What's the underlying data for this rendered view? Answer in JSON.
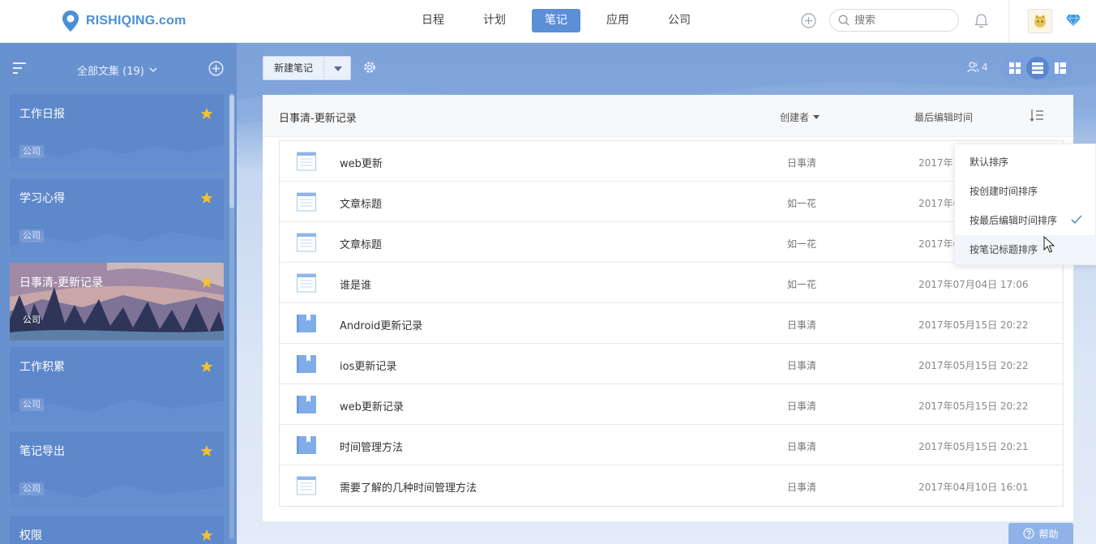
{
  "brand": {
    "name": "RISHIQING.com",
    "color": "#4a8fd8"
  },
  "nav": {
    "items": [
      {
        "label": "日程"
      },
      {
        "label": "计划"
      },
      {
        "label": "笔记",
        "active": true
      },
      {
        "label": "应用"
      },
      {
        "label": "公司"
      }
    ]
  },
  "search": {
    "placeholder": "搜索"
  },
  "sidebar": {
    "collection_label": "全部文集 (19)",
    "cards": [
      {
        "title": "工作日报",
        "tag": "公司",
        "starred": true
      },
      {
        "title": "学习心得",
        "tag": "公司",
        "starred": true
      },
      {
        "title": "日事清-更新记录",
        "tag": "公司",
        "starred": true,
        "selected": true
      },
      {
        "title": "工作积累",
        "tag": "公司",
        "starred": true
      },
      {
        "title": "笔记导出",
        "tag": "公司",
        "starred": true
      },
      {
        "title": "权限",
        "tag": "",
        "starred": true
      }
    ]
  },
  "toolbar": {
    "new_note_label": "新建笔记",
    "member_count": "4"
  },
  "panel": {
    "title": "日事清-更新记录",
    "col_creator": "创建者",
    "col_edited": "最后编辑时间"
  },
  "notes": [
    {
      "title": "web更新",
      "creator": "日事清",
      "time": "2017年1",
      "type": "doc"
    },
    {
      "title": "文章标题",
      "creator": "如一花",
      "time": "2017年0",
      "type": "doc"
    },
    {
      "title": "文章标题",
      "creator": "如一花",
      "time": "2017年0",
      "type": "doc"
    },
    {
      "title": "谁是谁",
      "creator": "如一花",
      "time": "2017年07月04日 17:06",
      "type": "doc"
    },
    {
      "title": "Android更新记录",
      "creator": "日事清",
      "time": "2017年05月15日 20:22",
      "type": "book"
    },
    {
      "title": "ios更新记录",
      "creator": "日事清",
      "time": "2017年05月15日 20:22",
      "type": "book"
    },
    {
      "title": "web更新记录",
      "creator": "日事清",
      "time": "2017年05月15日 20:22",
      "type": "book"
    },
    {
      "title": "时间管理方法",
      "creator": "日事清",
      "time": "2017年05月15日 20:21",
      "type": "book"
    },
    {
      "title": "需要了解的几种时间管理方法",
      "creator": "日事清",
      "time": "2017年04月10日 16:01",
      "type": "doc"
    }
  ],
  "sort_menu": {
    "items": [
      {
        "label": "默认排序"
      },
      {
        "label": "按创建时间排序"
      },
      {
        "label": "按最后编辑时间排序",
        "checked": true
      },
      {
        "label": "按笔记标题排序",
        "hovered": true
      }
    ]
  },
  "help": {
    "label": "帮助"
  },
  "colors": {
    "accent": "#5b8fd6",
    "sidebar": "#6892cf",
    "star": "#f5c12e",
    "check": "#5b8fd6"
  },
  "icons": {
    "logo": "location-pin-icon",
    "add": "plus-circle-icon",
    "search": "search-icon",
    "bell": "bell-icon",
    "avatar": "avatar-image",
    "vip": "diamond-icon",
    "sort": "sort-lines-icon",
    "settings": "gear-icon",
    "members": "user-icon",
    "views": [
      "grid-view-icon",
      "list-view-icon",
      "split-view-icon"
    ],
    "star": "star-icon",
    "note": "document-icon",
    "book": "book-icon",
    "check": "check-icon",
    "help": "question-circle-icon"
  }
}
